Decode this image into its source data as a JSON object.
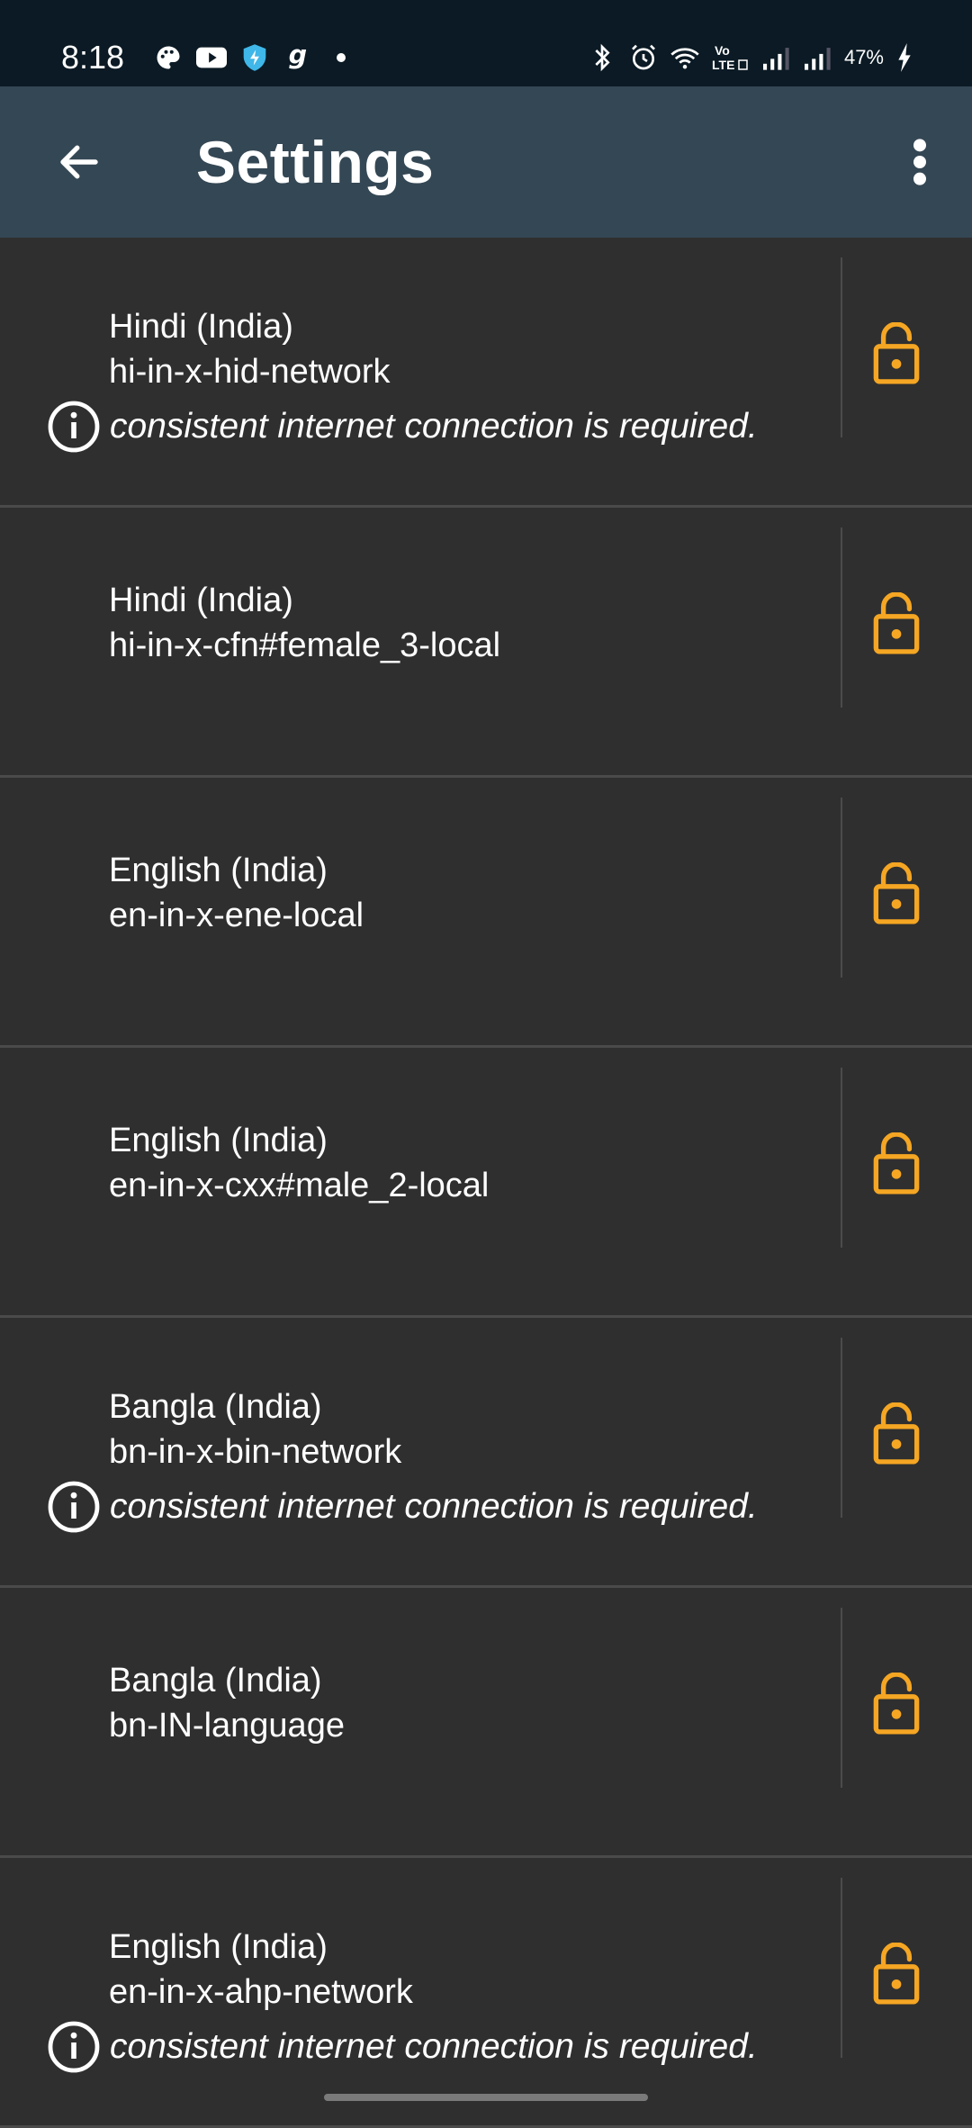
{
  "status_bar": {
    "time": "8:18",
    "left_icons": [
      "palette-icon",
      "youtube-icon",
      "shield-icon",
      "g-app-icon",
      "dot-icon"
    ],
    "right_icons": [
      "bluetooth-icon",
      "alarm-icon",
      "wifi-icon",
      "volte-icon",
      "signal-icon",
      "signal-icon-2"
    ],
    "battery_text": "47%",
    "vo_lte_label": "Vo\nLTE"
  },
  "app_bar": {
    "title": "Settings",
    "back_icon": "arrow-left-icon",
    "menu_icon": "more-vertical-icon"
  },
  "colors": {
    "status_bar_bg": "#0b1a24",
    "app_bar_bg": "#344754",
    "list_bg": "#2f2f2f",
    "lock_accent": "#f5a623",
    "divider": "#4a4a4a"
  },
  "voices": [
    {
      "language": "Hindi (India)",
      "voice_id": "hi-in-x-hid-network",
      "note": "consistent internet connection is required."
    },
    {
      "language": "Hindi (India)",
      "voice_id": "hi-in-x-cfn#female_3-local",
      "note": ""
    },
    {
      "language": "English (India)",
      "voice_id": "en-in-x-ene-local",
      "note": ""
    },
    {
      "language": "English (India)",
      "voice_id": "en-in-x-cxx#male_2-local",
      "note": ""
    },
    {
      "language": "Bangla (India)",
      "voice_id": "bn-in-x-bin-network",
      "note": "consistent internet connection is required."
    },
    {
      "language": "Bangla (India)",
      "voice_id": "bn-IN-language",
      "note": ""
    },
    {
      "language": "English (India)",
      "voice_id": "en-in-x-ahp-network",
      "note": "consistent internet connection is required."
    }
  ]
}
